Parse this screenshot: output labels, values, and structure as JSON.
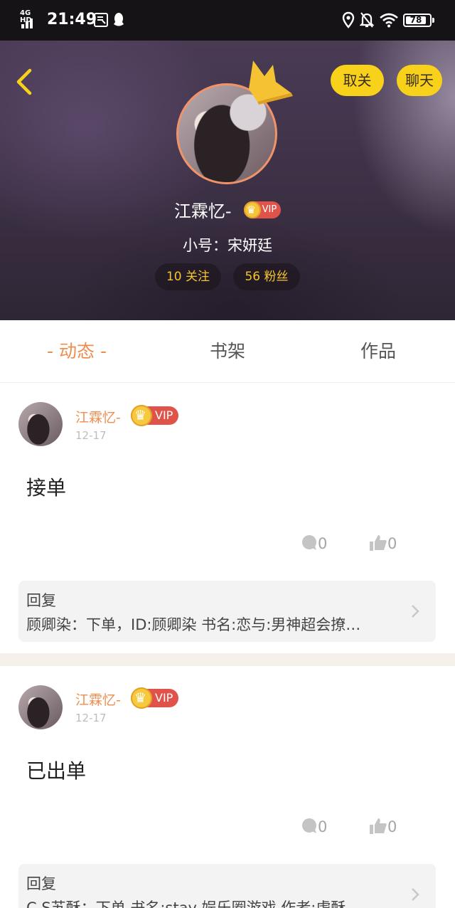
{
  "status_bar": {
    "network": "4G HD",
    "time": "21:49",
    "battery": "78",
    "icons": [
      "app-notification-icon",
      "qq-icon",
      "location-icon",
      "mute-bell-icon",
      "wifi-icon",
      "battery-icon"
    ]
  },
  "header": {
    "unfollow_label": "取关",
    "chat_label": "聊天",
    "username": "江霖忆-",
    "vip_label": "VIP",
    "alt_name": "小号：宋妍廷",
    "following": "10 关注",
    "fans": "56 粉丝"
  },
  "tabs": [
    {
      "label": "- 动态 -",
      "active": true
    },
    {
      "label": "书架",
      "active": false
    },
    {
      "label": "作品",
      "active": false
    }
  ],
  "posts": [
    {
      "author": "江霖忆-",
      "vip": "VIP",
      "date": "12-17",
      "text": "接单",
      "comments": "0",
      "likes": "0",
      "reply_title": "回复",
      "reply_text": "顾卿染：下单，ID:顾卿染  书名:恋与:男神超会撩…"
    },
    {
      "author": "江霖忆-",
      "vip": "VIP",
      "date": "12-17",
      "text": "已出单",
      "comments": "0",
      "likes": "0",
      "reply_title": "回复",
      "reply_text": "C.S苏酥：下单 书名:stay 娱乐圈游戏  作者:虐酥"
    }
  ],
  "colors": {
    "accent_orange": "#ef8d4f",
    "button_yellow": "#f8d21a",
    "vip_red": "#e0534a"
  }
}
